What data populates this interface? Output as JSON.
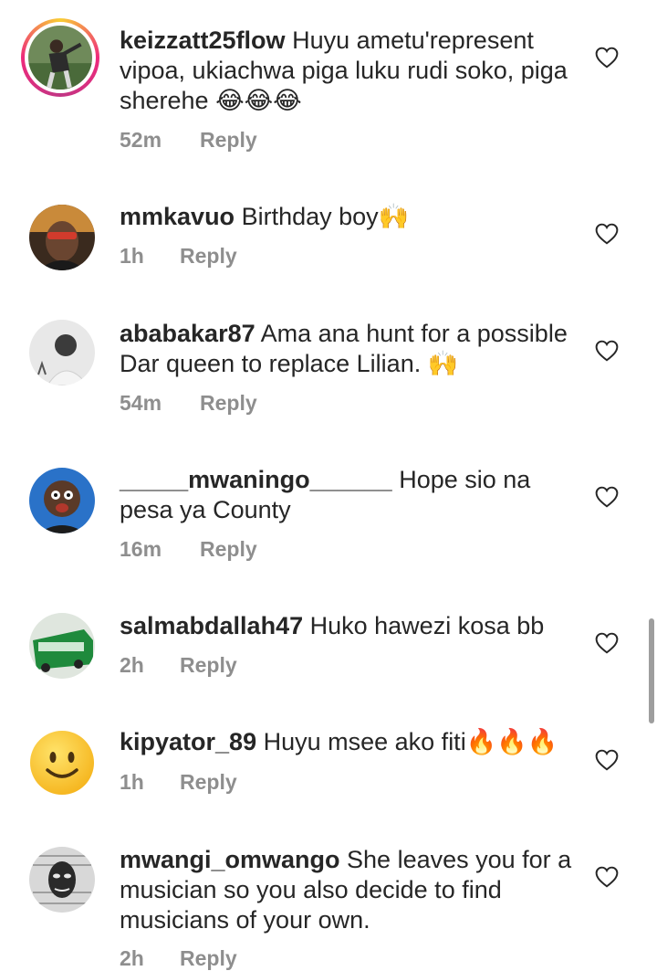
{
  "comments": [
    {
      "username": "keizzatt25flow",
      "text": " Huyu ametu'represent vipoa, ukiachwa piga luku rudi soko, piga sherehe ",
      "emoji": "😂😂😂",
      "time": "52m",
      "reply_label": "Reply"
    },
    {
      "username": "mmkavuo",
      "text": " Birthday boy",
      "emoji": "🙌",
      "time": "1h",
      "reply_label": "Reply"
    },
    {
      "username": "ababakar87",
      "text": " Ama ana hunt for a possible Dar queen to replace Lilian. ",
      "emoji": "🙌",
      "time": "54m",
      "reply_label": "Reply"
    },
    {
      "username": "_____mwaningo______",
      "text": " Hope sio na pesa ya County",
      "emoji": "",
      "time": "16m",
      "reply_label": "Reply"
    },
    {
      "username": "salmabdallah47",
      "text": " Huko hawezi kosa bb",
      "emoji": "",
      "time": "2h",
      "reply_label": "Reply"
    },
    {
      "username": "kipyator_89",
      "text": " Huyu msee ako fiti",
      "emoji": "🔥🔥🔥",
      "time": "1h",
      "reply_label": "Reply"
    },
    {
      "username": "mwangi_omwango",
      "text": " She leaves you for a musician so you also decide to find musicians of your own.",
      "emoji": "",
      "time": "2h",
      "reply_label": "Reply"
    }
  ],
  "icons": {
    "like": "heart-outline-icon"
  },
  "colors": {
    "text": "#262626",
    "meta": "#8e8e8e",
    "story_ring_start": "#f9ce34",
    "story_ring_end": "#c13584"
  }
}
